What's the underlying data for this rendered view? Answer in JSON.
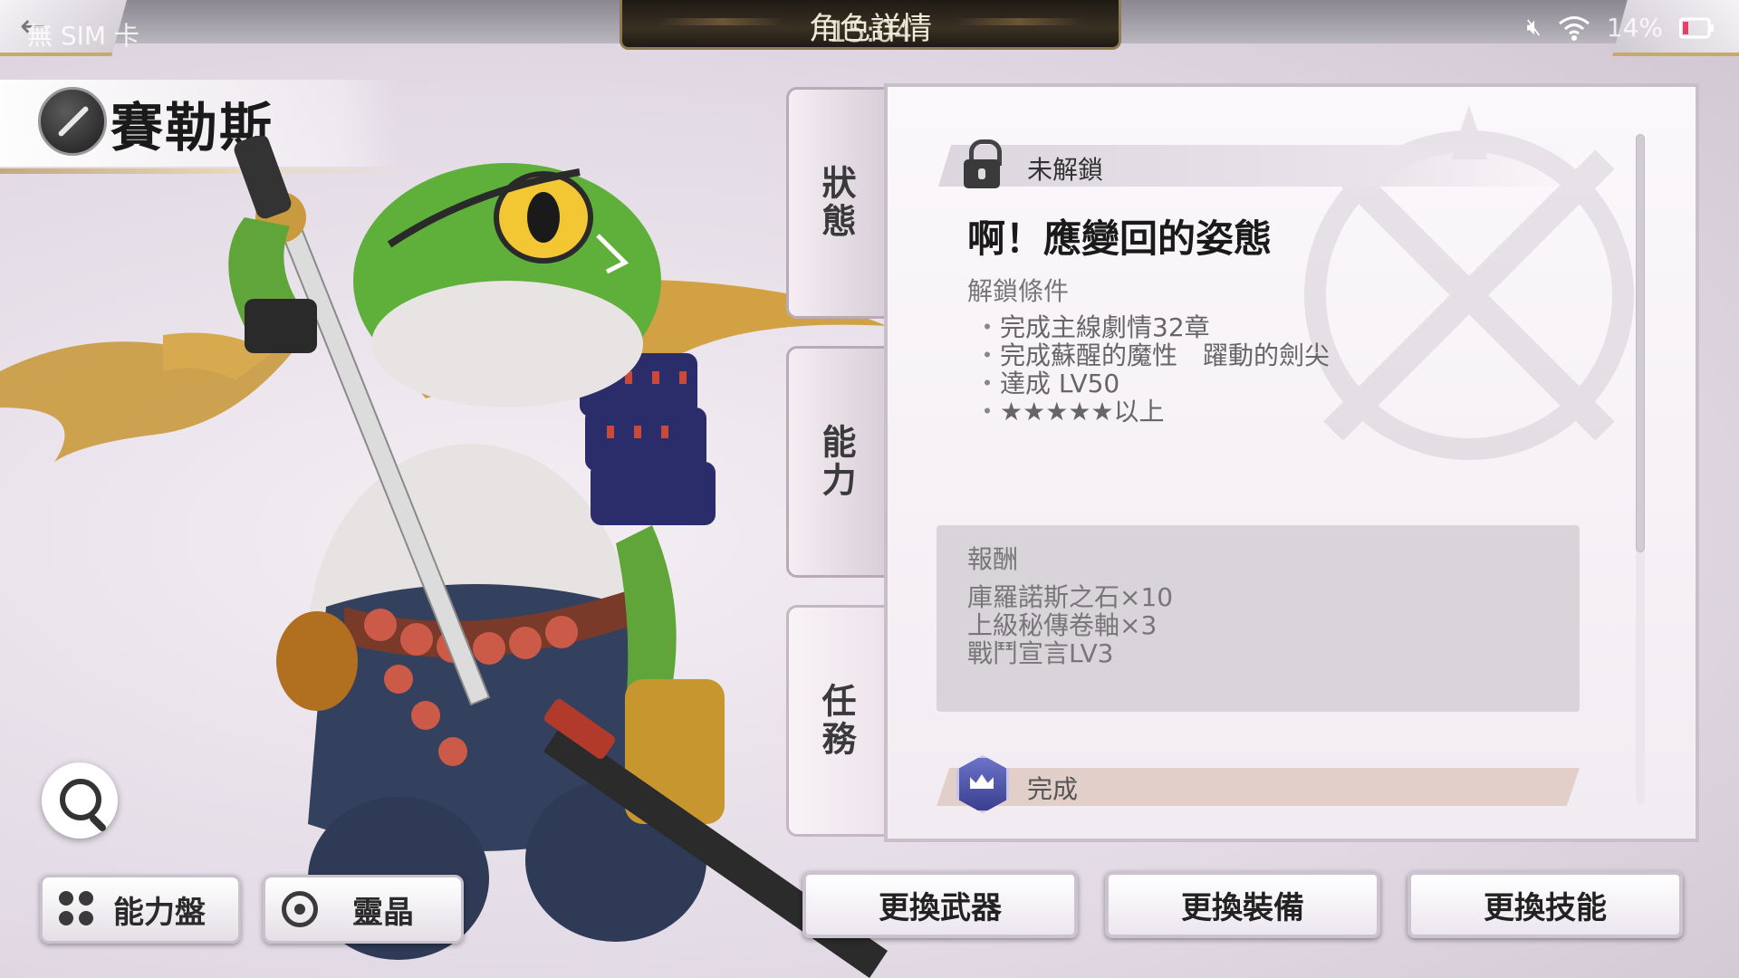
{
  "status_bar": {
    "carrier": "無 SIM 卡",
    "time": "15:04",
    "battery": "14%",
    "icons": [
      "mute-icon",
      "wifi-icon",
      "battery-icon"
    ]
  },
  "header": {
    "screen_title": "角色詳情",
    "back_icon": "back-arrow-icon"
  },
  "character": {
    "name": "賽勒斯",
    "weapon_icon": "sword-icon"
  },
  "side_tabs": [
    {
      "label": "狀態",
      "active": false
    },
    {
      "label": "能力",
      "active": false
    },
    {
      "label": "任務",
      "active": true
    }
  ],
  "quest": {
    "lock_status": "未解鎖",
    "title": "啊！應變回的姿態",
    "condition_label": "解鎖條件",
    "conditions": [
      "完成主線劇情32章",
      "完成蘇醒的魔性　躍動的劍尖",
      "達成 LV50",
      "★★★★★以上"
    ],
    "reward_label": "報酬",
    "rewards": [
      "庫羅諾斯之石×10",
      "上級秘傳卷軸×3",
      "戰鬥宣言LV3"
    ],
    "completion_label": "完成"
  },
  "left_buttons": {
    "abilities": "能力盤",
    "spirit": "靈晶"
  },
  "action_buttons": {
    "weapon": "更換武器",
    "equipment": "更換裝備",
    "skill": "更換技能"
  },
  "colors": {
    "panel_bg": "#f7f3f7",
    "reward_box": "#d9d4da",
    "completion_bar": "#e3cfca",
    "gold_accent": "#c9a86b"
  }
}
